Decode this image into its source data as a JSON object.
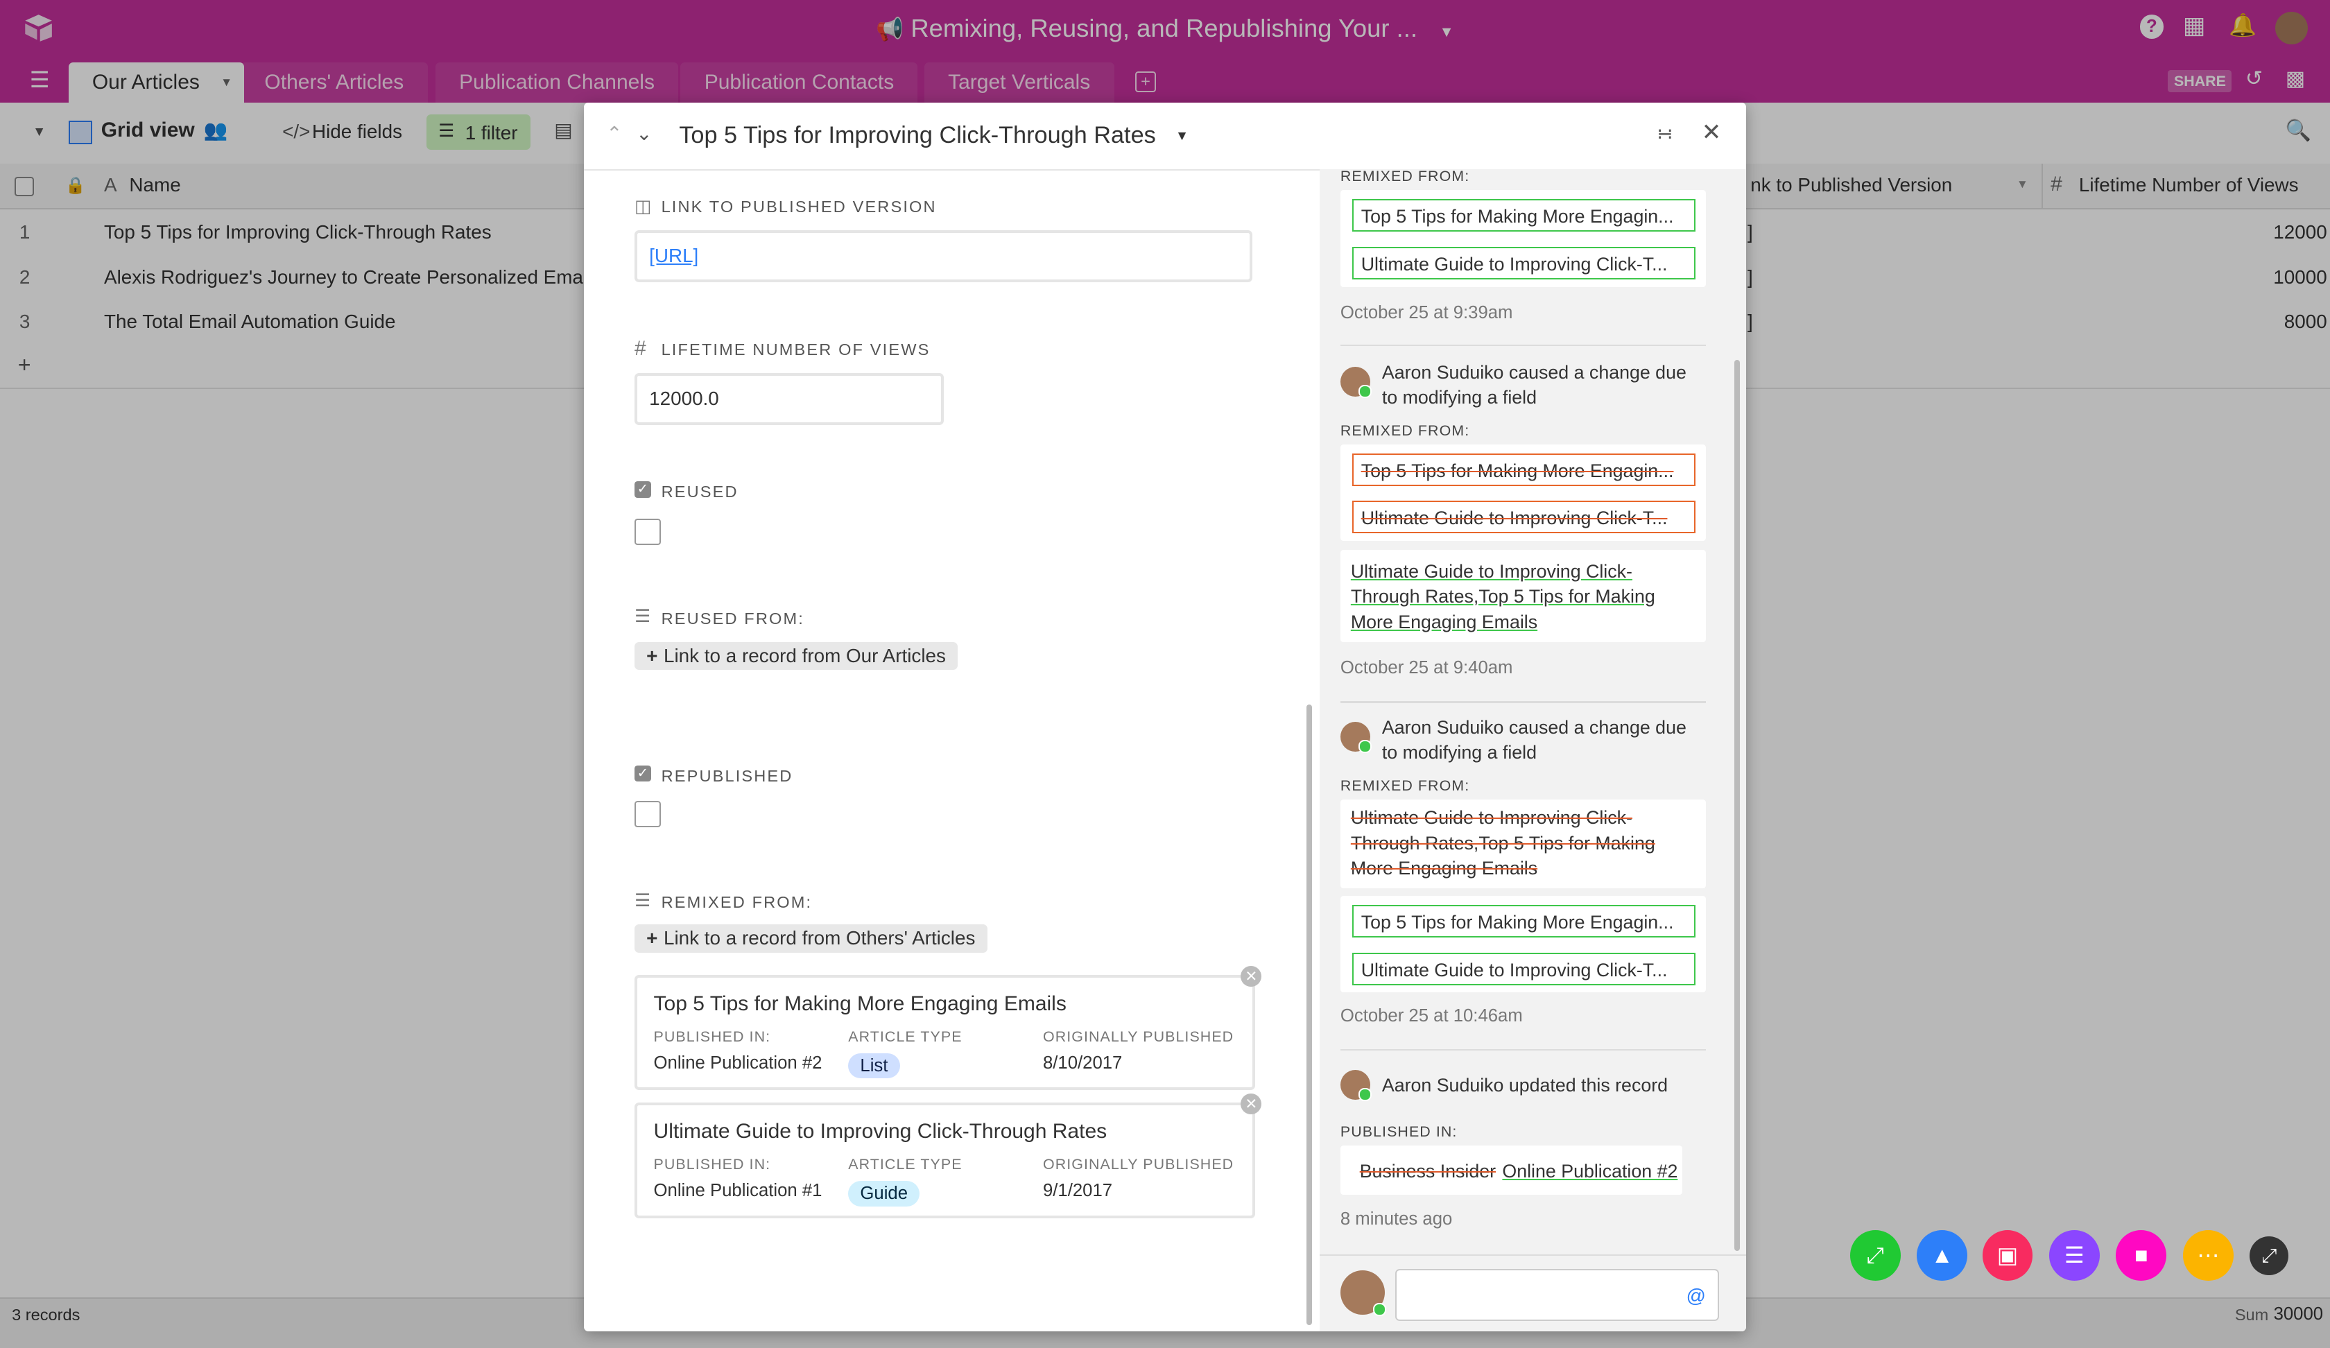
{
  "app": {
    "base_title": "Remixing, Reusing, and Republishing Your ...",
    "share_label": "SHARE"
  },
  "tabs": [
    "Our Articles",
    "Others' Articles",
    "Publication Channels",
    "Publication Contacts",
    "Target Verticals"
  ],
  "toolbar": {
    "view_name": "Grid view",
    "hide_fields": "Hide fields",
    "filter": "1 filter"
  },
  "grid": {
    "col_name": "Name",
    "col_link": "nk to Published Version",
    "col_views": "Lifetime Number of Views",
    "rows": [
      {
        "num": "1",
        "name": "Top 5 Tips for Improving Click-Through Rates",
        "link": "]",
        "views": "12000"
      },
      {
        "num": "2",
        "name": "Alexis Rodriguez's Journey to Create Personalized Emails",
        "link": "]",
        "views": "10000"
      },
      {
        "num": "3",
        "name": "The Total Email Automation Guide",
        "link": "]",
        "views": "8000"
      }
    ],
    "add_row": "+",
    "records_count": "3 records",
    "sum_label": "Sum",
    "sum_value": "30000"
  },
  "record": {
    "title": "Top 5 Tips for Improving Click-Through Rates",
    "fields": {
      "link_label": "LINK TO PUBLISHED VERSION",
      "link_value": "[URL]",
      "views_label": "LIFETIME NUMBER OF VIEWS",
      "views_value": "12000.0",
      "reused_label": "REUSED",
      "reused_from_label": "REUSED FROM:",
      "reused_link_btn": "Link to a record from Our Articles",
      "republished_label": "REPUBLISHED",
      "remixed_from_label": "REMIXED FROM:",
      "remixed_link_btn": "Link to a record from Others' Articles"
    },
    "linked": [
      {
        "title": "Top 5 Tips for Making More Engaging Emails",
        "pub_label": "PUBLISHED IN:",
        "pub": "Online Publication #2",
        "type_label": "ARTICLE TYPE",
        "type": "List",
        "orig_label": "ORIGINALLY PUBLISHED",
        "orig": "8/10/2017"
      },
      {
        "title": "Ultimate Guide to Improving Click-Through Rates",
        "pub_label": "PUBLISHED IN:",
        "pub": "Online Publication #1",
        "type_label": "ARTICLE TYPE",
        "type": "Guide",
        "orig_label": "ORIGINALLY PUBLISHED",
        "orig": "9/1/2017"
      }
    ]
  },
  "activity": {
    "a1_label": "REMIXED FROM:",
    "a1_g1": "Top 5 Tips for Making More Engagin...",
    "a1_g2": "Ultimate Guide to Improving Click-T...",
    "a1_time": "October 25 at 9:39am",
    "a2_who": "Aaron Suduiko caused a change due to modifying a field",
    "a2_label": "REMIXED FROM:",
    "a2_r1": "Top 5 Tips for Making More Engagin...",
    "a2_r2": "Ultimate Guide to Improving Click-T...",
    "a2_added": "Ultimate Guide to Improving Click-Through Rates,Top 5 Tips for Making More Engaging Emails",
    "a2_time": "October 25 at 9:40am",
    "a3_who": "Aaron Suduiko caused a change due to modifying a field",
    "a3_label": "REMIXED FROM:",
    "a3_removed": "Ultimate Guide to Improving Click-Through Rates,Top 5 Tips for Making More Engaging Emails",
    "a3_g1": "Top 5 Tips for Making More Engagin...",
    "a3_g2": "Ultimate Guide to Improving Click-T...",
    "a3_time": "October 25 at 10:46am",
    "a4_who": "Aaron Suduiko updated this record",
    "a4_label": "PUBLISHED IN:",
    "a4_old": "Business Insider",
    "a4_new": "Online Publication #2",
    "a4_time": "8 minutes ago",
    "comment_at": "@"
  },
  "colors": {
    "brand": "#c4309c",
    "added": "#3ec74b",
    "removed": "#e8662a"
  }
}
